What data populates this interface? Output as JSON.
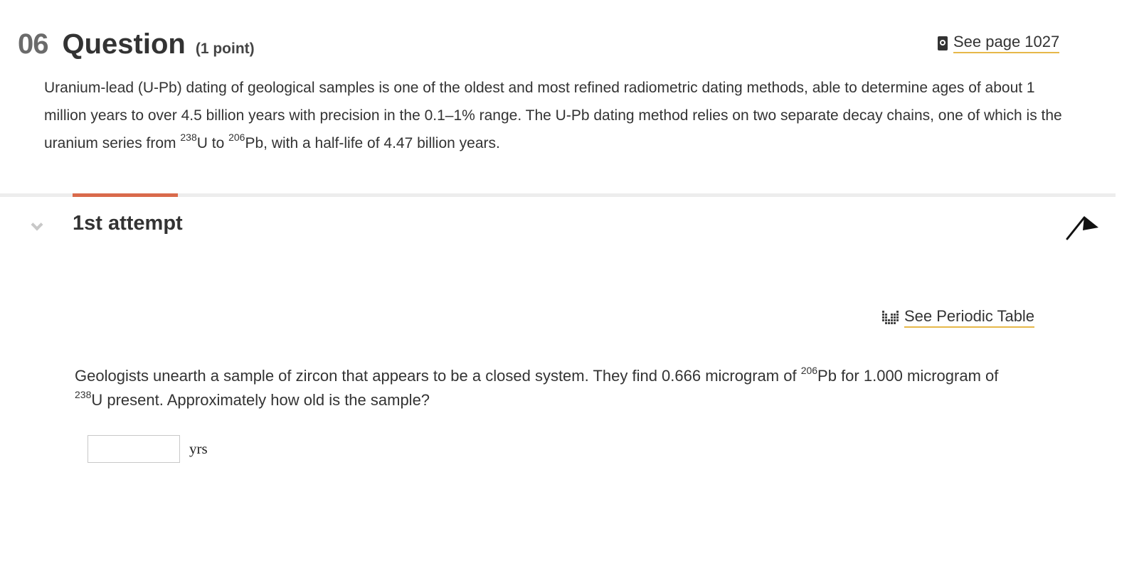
{
  "question": {
    "number": "06",
    "label": "Question",
    "points": "(1 point)",
    "reference_link": "See page 1027",
    "intro": {
      "part1": "Uranium-lead (U-Pb) dating of geological samples is one of the oldest and most refined radiometric dating methods, able to determine ages of about 1 million years to over 4.5 billion years with precision in the 0.1–1% range. The U-Pb dating method relies on two separate decay chains, one of which is the uranium series from ",
      "sup1": "238",
      "part2": "U to ",
      "sup2": "206",
      "part3": "Pb, with a half-life of 4.47 billion years."
    }
  },
  "attempt": {
    "title": "1st attempt",
    "accent_color": "#d96a4b"
  },
  "periodic_link": "See Periodic Table",
  "problem": {
    "part1": "Geologists unearth a sample of zircon that appears to be a closed system. They find 0.666 microgram of ",
    "sup1": "206",
    "part2": "Pb for 1.000 microgram of ",
    "sup2": "238",
    "part3": "U present. Approximately how old is the sample?"
  },
  "answer": {
    "value": "",
    "unit": "yrs"
  },
  "icons": {
    "book": "book-icon",
    "chevron": "chevron-down-icon",
    "flag": "flag-icon",
    "periodic": "periodic-table-icon"
  },
  "colors": {
    "link_underline": "#e6b84a",
    "divider": "#ededed"
  }
}
